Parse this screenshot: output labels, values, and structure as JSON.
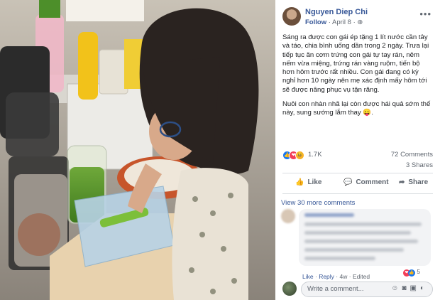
{
  "post": {
    "author": "Nguyen Diep Chi",
    "follow": "Follow",
    "dot": "·",
    "date": "April 8 ·",
    "globe": "⊕",
    "more": "•••",
    "paragraph1": "Sáng ra được con gái ép tặng 1 lít nước cần tây và táo, chia bình uống dần trong 2 ngày. Trưa lại tiếp tục ăn cơm trứng con gái tự tay rán, nêm nếm vừa miệng, trứng rán vàng ruộm, tiến bộ hơn hôm trước rất nhiều. Con gái đang có kỳ nghỉ hơn 10 ngày nên mẹ xác định mấy hôm tới sẽ được nâng phục vụ tận răng.",
    "paragraph2": "Nuôi con nhàn nhã lại còn được hái quả sớm thế này, sung sướng lắm thay 😛."
  },
  "reactions": {
    "count": "1.7K",
    "comments": "72 Comments",
    "shares": "3 Shares",
    "icons": [
      "like-icon",
      "love-icon",
      "haha-icon"
    ]
  },
  "actions": {
    "like": "Like",
    "comment": "Comment",
    "share": "Share"
  },
  "comments": {
    "view_more": "View 30 more comments",
    "like": "Like",
    "reply": "Reply",
    "time": "4w",
    "edited": "Edited",
    "reaction_count": "5"
  },
  "composer": {
    "placeholder": "Write a comment..."
  }
}
